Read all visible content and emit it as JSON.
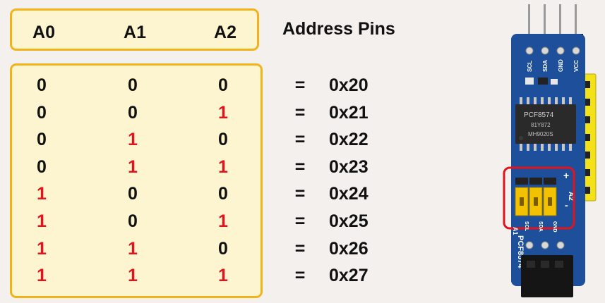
{
  "header": {
    "columns": [
      "A0",
      "A1",
      "A2"
    ],
    "title": "Address Pins"
  },
  "table": {
    "equals": "=",
    "rows": [
      {
        "bits": [
          0,
          0,
          0
        ],
        "address": "0x20"
      },
      {
        "bits": [
          0,
          0,
          1
        ],
        "address": "0x21"
      },
      {
        "bits": [
          0,
          1,
          0
        ],
        "address": "0x22"
      },
      {
        "bits": [
          0,
          1,
          1
        ],
        "address": "0x23"
      },
      {
        "bits": [
          1,
          0,
          0
        ],
        "address": "0x24"
      },
      {
        "bits": [
          1,
          0,
          1
        ],
        "address": "0x25"
      },
      {
        "bits": [
          1,
          1,
          0
        ],
        "address": "0x26"
      },
      {
        "bits": [
          1,
          1,
          1
        ],
        "address": "0x27"
      }
    ]
  },
  "colors": {
    "zero": "#111111",
    "one": "#e0141c",
    "box_border": "#f0b31a",
    "box_fill": "#fdf5cf",
    "pcb": "#1d4f9a",
    "highlight": "#e0141c"
  },
  "board": {
    "pin_labels": [
      "SCL",
      "SDA",
      "GND",
      "VCC"
    ],
    "chip_label": "PCF8574",
    "chip_sub": "81Y872",
    "chip_code": "MH9020S",
    "plus": "+",
    "minus": "-",
    "jumper_label": "A2",
    "side_label": "A1",
    "bottom_label": "PCF8574",
    "bottom_pin_labels": [
      "SCL",
      "SDA",
      "GND"
    ]
  }
}
